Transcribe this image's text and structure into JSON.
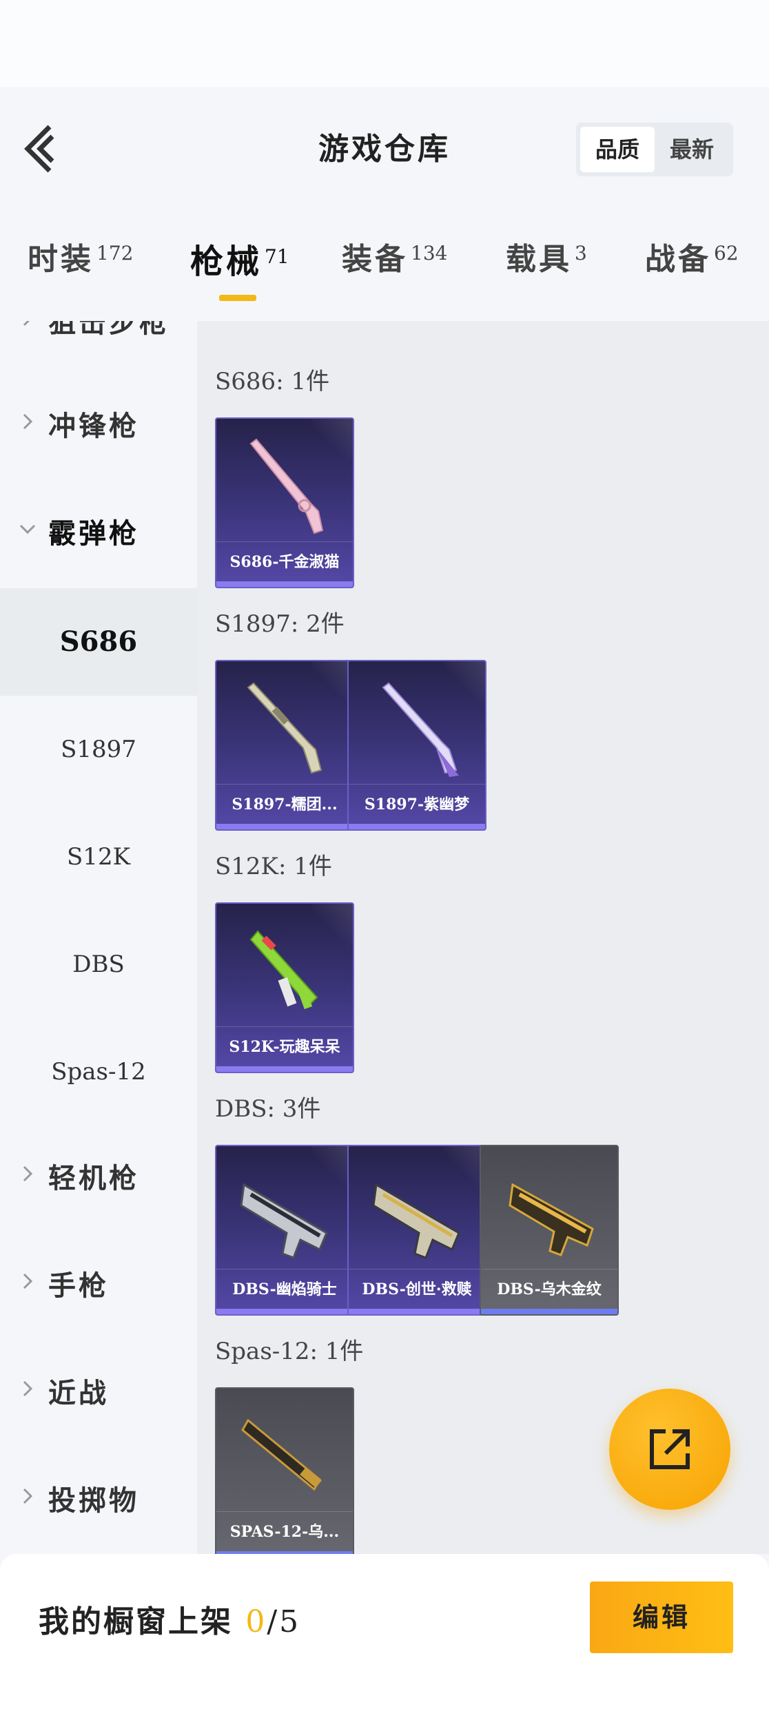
{
  "header": {
    "title": "游戏仓库",
    "sort_options": [
      "品质",
      "最新"
    ]
  },
  "tabs": [
    {
      "name": "时装",
      "count": "172"
    },
    {
      "name": "枪械",
      "count": "71"
    },
    {
      "name": "装备",
      "count": "134"
    },
    {
      "name": "载具",
      "count": "3"
    },
    {
      "name": "战备",
      "count": "62"
    }
  ],
  "sidebar": {
    "partial_top": "狙击步枪",
    "categories": [
      "冲锋枪",
      "霰弹枪",
      "轻机枪",
      "手枪",
      "近战",
      "投掷物"
    ],
    "subitems": [
      "S686",
      "S1897",
      "S12K",
      "DBS",
      "Spas-12"
    ]
  },
  "groups": [
    {
      "title": "S686: 1件",
      "items": [
        {
          "name": "S686-千金淑猫",
          "rarity": "purple"
        }
      ]
    },
    {
      "title": "S1897: 2件",
      "items": [
        {
          "name": "S1897-糯团...",
          "rarity": "purple"
        },
        {
          "name": "S1897-紫幽梦",
          "rarity": "purple"
        }
      ]
    },
    {
      "title": "S12K: 1件",
      "items": [
        {
          "name": "S12K-玩趣呆呆",
          "rarity": "purple"
        }
      ]
    },
    {
      "title": "DBS: 3件",
      "items": [
        {
          "name": "DBS-幽焰骑士",
          "rarity": "purple"
        },
        {
          "name": "DBS-创世·救赎",
          "rarity": "purple"
        },
        {
          "name": "DBS-乌木金纹",
          "rarity": "grey"
        }
      ]
    },
    {
      "title": "Spas-12: 1件",
      "items": [
        {
          "name": "SPAS-12-乌...",
          "rarity": "grey"
        }
      ]
    }
  ],
  "bottom": {
    "showcase_label": "我的橱窗上架",
    "showcase_count": "0",
    "showcase_total": "/5",
    "edit_label": "编辑"
  },
  "colors": {
    "accent": "#f4b814",
    "purple_card": "#3a3478",
    "grey_card": "#5b5c63"
  }
}
